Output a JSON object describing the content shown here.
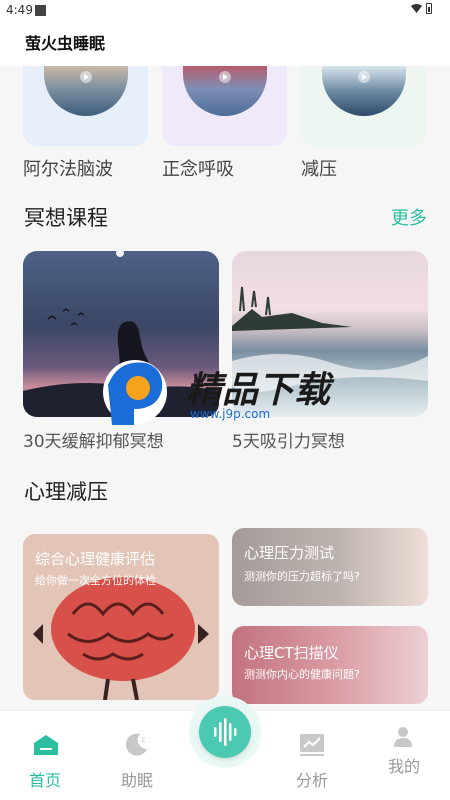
{
  "status_bar": {
    "time": "4:49"
  },
  "app": {
    "title": "萤火虫睡眠"
  },
  "mini_cards": [
    {
      "label": "阿尔法脑波"
    },
    {
      "label": "正念呼吸"
    },
    {
      "label": "减压"
    }
  ],
  "meditation": {
    "title": "冥想课程",
    "more": "更多",
    "courses": [
      {
        "label": "30天缓解抑郁冥想"
      },
      {
        "label": "5天吸引力冥想"
      }
    ]
  },
  "psychology": {
    "title": "心理减压",
    "cards": [
      {
        "title": "综合心理健康评估",
        "subtitle": "给你做一次全方位的体检"
      },
      {
        "title": "心理压力测试",
        "subtitle": "测测你的压力超标了吗?"
      },
      {
        "title": "心理CT扫描仪",
        "subtitle": "测测你内心的健康问题?"
      }
    ]
  },
  "watermark": {
    "text": "精品下载",
    "url": "www.j9p.com"
  },
  "nav": {
    "items": [
      {
        "label": "首页",
        "icon": "home-icon",
        "active": true
      },
      {
        "label": "助眠",
        "icon": "moon-icon"
      },
      {
        "label": "分析",
        "icon": "chart-icon"
      },
      {
        "label": "我的",
        "icon": "user-icon"
      }
    ],
    "center_icon": "soundwave-icon"
  },
  "colors": {
    "accent": "#2bbfa0",
    "nav_inactive": "#999999"
  }
}
